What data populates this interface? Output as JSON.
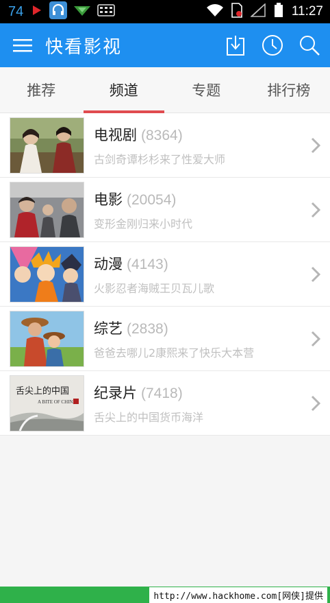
{
  "status_bar": {
    "left_number": "74",
    "time": "11:27",
    "icons": [
      "youtube-play-icon",
      "headphones-app-icon",
      "send-icon",
      "keyboard-icon",
      "wifi-icon",
      "sim-icon",
      "signal-icon",
      "battery-icon"
    ]
  },
  "app_bar": {
    "title": "快看影视",
    "background": "#1e8ff0",
    "actions": [
      "download-icon",
      "history-clock-icon",
      "search-icon"
    ]
  },
  "tabs": [
    {
      "label": "推荐",
      "active": false
    },
    {
      "label": "频道",
      "active": true
    },
    {
      "label": "专题",
      "active": false
    },
    {
      "label": "排行榜",
      "active": false
    }
  ],
  "channels": [
    {
      "title": "电视剧",
      "count": "(8364)",
      "subtitle": "古剑奇谭杉杉来了性爱大师"
    },
    {
      "title": "电影",
      "count": "(20054)",
      "subtitle": "变形金刚归来小时代"
    },
    {
      "title": "动漫",
      "count": "(4143)",
      "subtitle": "火影忍者海贼王贝瓦儿歌"
    },
    {
      "title": "综艺",
      "count": "(2838)",
      "subtitle": "爸爸去哪儿2康熙来了快乐大本营"
    },
    {
      "title": "纪录片",
      "count": "(7418)",
      "subtitle": "舌尖上的中国货币海洋"
    }
  ],
  "thumb_text": {
    "doc_cn": "舌尖上的中国",
    "doc_en": "A BITE OF CHINA"
  },
  "footer": {
    "text": "http://www.hackhome.com[网侠]提供"
  },
  "colors": {
    "accent": "#1e8ff0",
    "tab_indicator": "#e04b4f",
    "footer_bar": "#2fb14a"
  }
}
